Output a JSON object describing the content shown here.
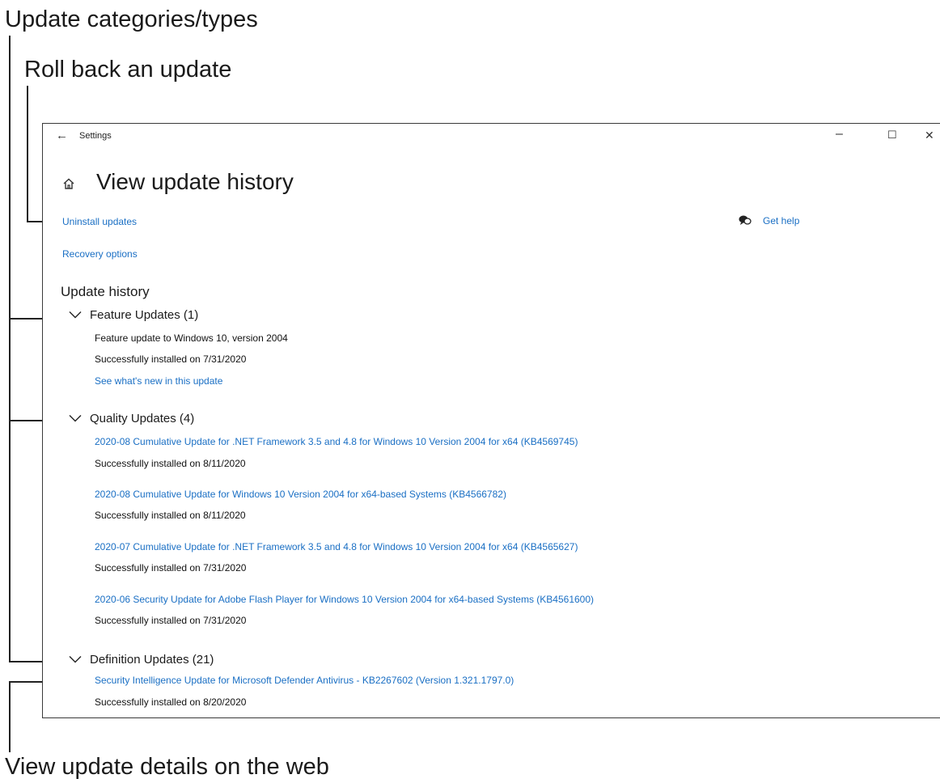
{
  "callouts": {
    "update_categories": "Update categories/types",
    "roll_back": "Roll back an update",
    "view_details": "View update details on the web"
  },
  "window": {
    "title": "Settings",
    "back_glyph": "←",
    "minimize_glyph": "–",
    "maximize_glyph": "☐",
    "close_glyph": "✕"
  },
  "page": {
    "title": "View update history",
    "home_icon": "home-icon"
  },
  "links": {
    "uninstall": "Uninstall updates",
    "recovery": "Recovery options",
    "get_help": "Get help"
  },
  "history": {
    "title": "Update history",
    "categories": [
      {
        "label": "Feature Updates (1)",
        "items": [
          {
            "name": "Feature update to Windows 10, version 2004",
            "status": "Successfully installed on 7/31/2020",
            "extra_link": "See what's new in this update"
          }
        ]
      },
      {
        "label": "Quality Updates (4)",
        "items": [
          {
            "name": "2020-08 Cumulative Update for .NET Framework 3.5 and 4.8 for Windows 10 Version 2004 for x64 (KB4569745)",
            "status": "Successfully installed on 8/11/2020"
          },
          {
            "name": "2020-08 Cumulative Update for Windows 10 Version 2004 for x64-based Systems (KB4566782)",
            "status": "Successfully installed on 8/11/2020"
          },
          {
            "name": "2020-07 Cumulative Update for .NET Framework 3.5 and 4.8 for Windows 10 Version 2004 for x64 (KB4565627)",
            "status": "Successfully installed on 7/31/2020"
          },
          {
            "name": "2020-06 Security Update for Adobe Flash Player for Windows 10 Version 2004 for x64-based Systems (KB4561600)",
            "status": "Successfully installed on 7/31/2020"
          }
        ]
      },
      {
        "label": "Definition Updates (21)",
        "items": [
          {
            "name": "Security Intelligence Update for Microsoft Defender Antivirus - KB2267602 (Version 1.321.1797.0)",
            "status": "Successfully installed on 8/20/2020"
          }
        ]
      }
    ]
  },
  "colors": {
    "link": "#1a6fc4",
    "text": "#1b1b1b",
    "callout_line": "#222222"
  }
}
